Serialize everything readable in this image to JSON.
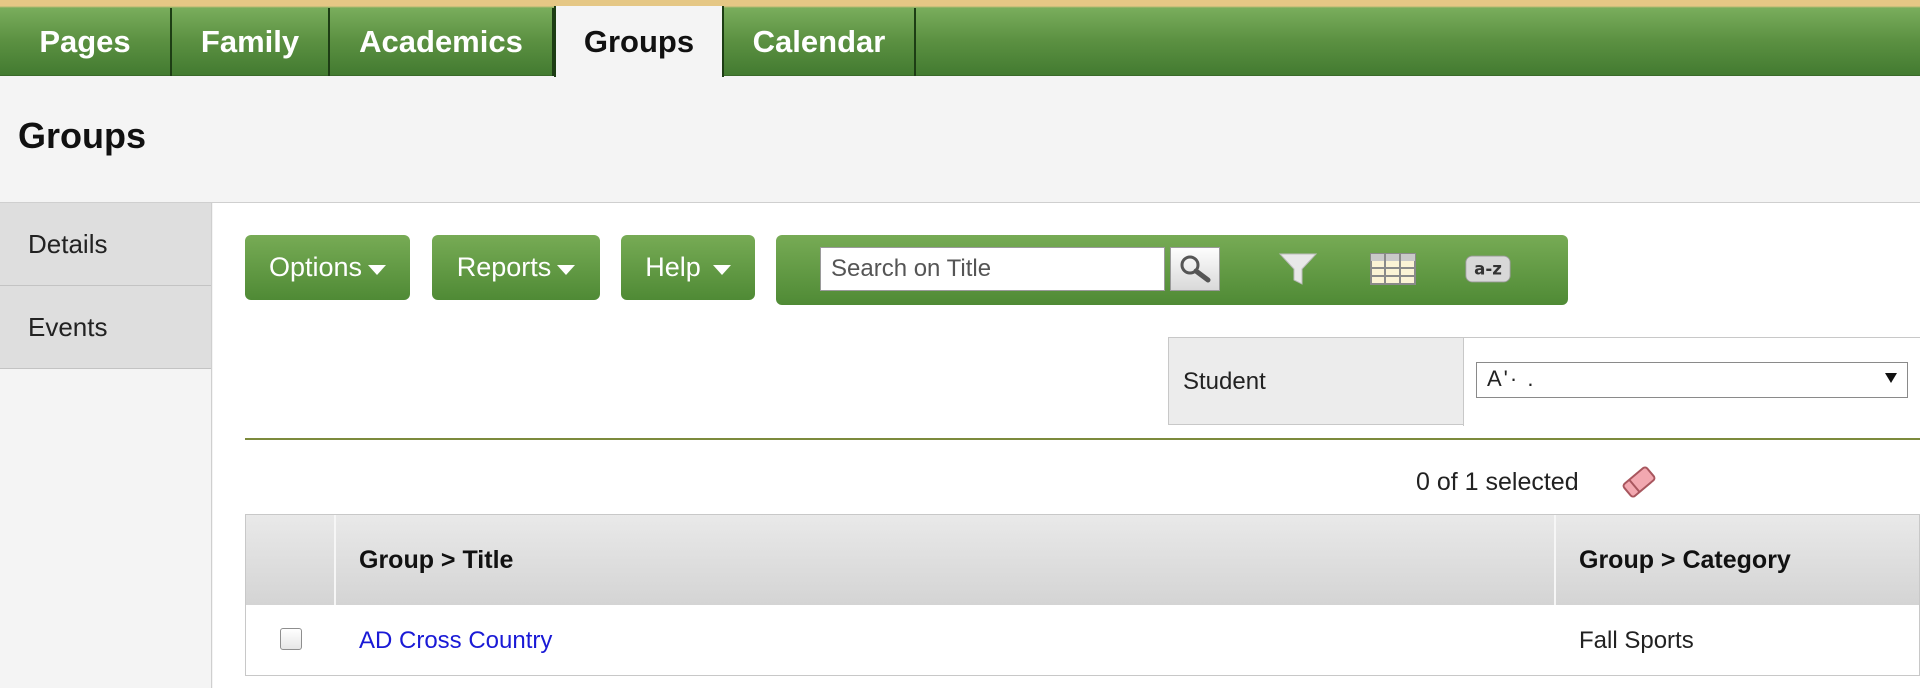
{
  "nav_tabs": [
    {
      "label": "Pages"
    },
    {
      "label": "Family"
    },
    {
      "label": "Academics"
    },
    {
      "label": "Groups",
      "active": true
    },
    {
      "label": "Calendar"
    }
  ],
  "page_title": "Groups",
  "side_nav": [
    {
      "label": "Details"
    },
    {
      "label": "Events"
    }
  ],
  "toolbar": {
    "options_label": "Options",
    "reports_label": "Reports",
    "help_label": "Help",
    "search_placeholder": "Search on Title"
  },
  "filter": {
    "label": "Student",
    "selected_value": "A'·  ."
  },
  "selection": {
    "text": "0 of 1 selected"
  },
  "table": {
    "columns": [
      "Group > Title",
      "Group > Category"
    ],
    "rows": [
      {
        "title": "AD Cross Country",
        "category": "Fall Sports",
        "checked": false
      }
    ]
  },
  "colors": {
    "tab_green": "#5c9142",
    "accent_gold": "#e5c785",
    "link_blue": "#1a1ad6"
  }
}
